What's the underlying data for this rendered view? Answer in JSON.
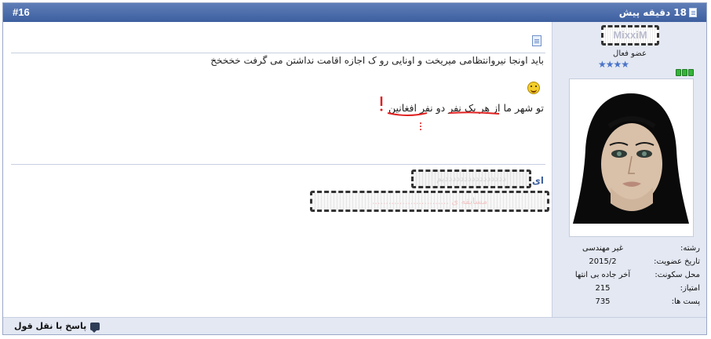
{
  "post": {
    "number": "#16",
    "date": "18 دقیقه پیش"
  },
  "user": {
    "username": "MixxiM",
    "title": "عضو فعال",
    "stars": "★★★★",
    "details": [
      {
        "label": "رشته:",
        "value": "غیر مهندسی"
      },
      {
        "label": "تاریخ عضویت:",
        "value": "2015/2"
      },
      {
        "label": "محل سکونت:",
        "value": "آخر جاده بی انتها"
      },
      {
        "label": "امتیاز:",
        "value": "215"
      },
      {
        "label": "پست ها:",
        "value": "735"
      }
    ]
  },
  "message": {
    "line1": "باید اونجا نیروانتظامی میریخت و اونایی رو ک اجازه اقامت نداشتن می گرفت خخخخخ",
    "line2": "تو شهر ما از هر یک نفر دو نفر افغانین"
  },
  "signature": {
    "label": "ای",
    "blurred1": "ددددددددددددددددیم",
    "blurred2": "مسابقه ی ............................"
  },
  "footer": {
    "quote_label": "پاسخ با نقل قول"
  },
  "colors": {
    "header": "#4a6aa8",
    "panel": "#e3e8f3",
    "annotation": "#e02020"
  },
  "icons": [
    "document-icon",
    "smiley-icon",
    "quote-icon",
    "online-status-icon",
    "star-icon"
  ]
}
